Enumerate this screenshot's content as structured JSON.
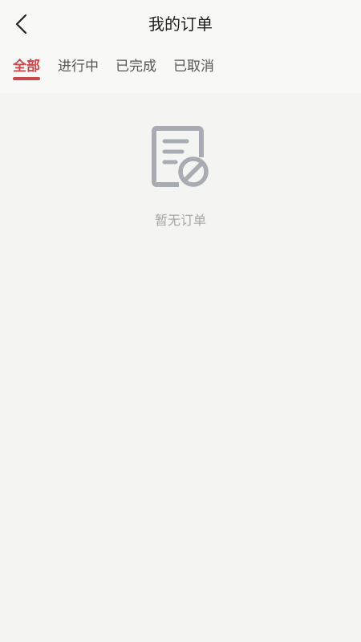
{
  "header": {
    "title": "我的订单",
    "back_icon": "chevron-left-icon"
  },
  "tabs": [
    {
      "label": "全部",
      "active": true
    },
    {
      "label": "进行中",
      "active": false
    },
    {
      "label": "已完成",
      "active": false
    },
    {
      "label": "已取消",
      "active": false
    }
  ],
  "empty_state": {
    "icon": "order-cancel-icon",
    "text": "暂无订单"
  },
  "colors": {
    "accent": "#c8484c",
    "background": "#f4f4f2",
    "muted_text": "#a6a6a6",
    "icon": "#a9abb2"
  }
}
